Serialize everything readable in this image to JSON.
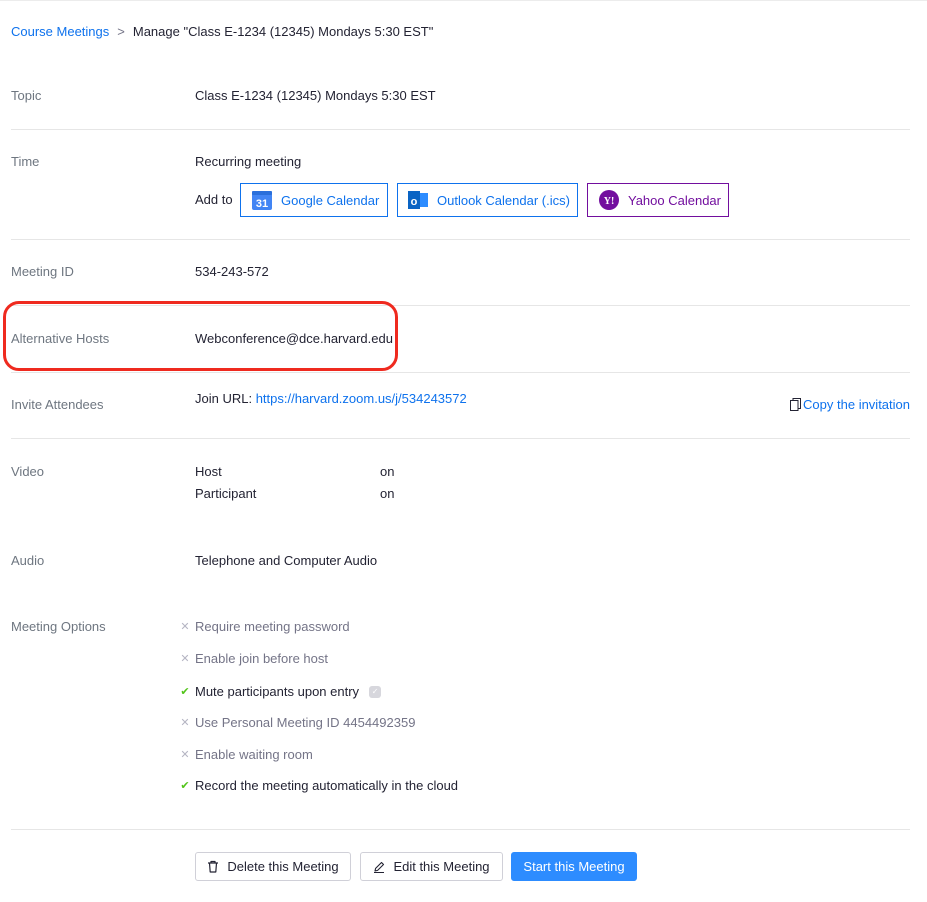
{
  "breadcrumb": {
    "parent": "Course Meetings",
    "separator": ">",
    "current": "Manage \"Class E-1234 (12345) Mondays 5:30 EST\""
  },
  "topic": {
    "label": "Topic",
    "value": "Class E-1234 (12345) Mondays 5:30 EST"
  },
  "time": {
    "label": "Time",
    "value": "Recurring meeting",
    "add_to": "Add to",
    "calendars": {
      "google": {
        "label": "Google Calendar",
        "icon": "google-calendar-icon",
        "icon_text": "31",
        "color": "#0e72ed"
      },
      "outlook": {
        "label": "Outlook Calendar (.ics)",
        "icon": "outlook-icon",
        "icon_text": "o",
        "color": "#0e72ed"
      },
      "yahoo": {
        "label": "Yahoo Calendar",
        "icon": "yahoo-icon",
        "icon_text": "Y!",
        "color": "#720e9e"
      }
    }
  },
  "meeting_id": {
    "label": "Meeting ID",
    "value": "534-243-572"
  },
  "alt_hosts": {
    "label": "Alternative Hosts",
    "value": "Webconference@dce.harvard.edu",
    "highlight_color": "#ef2a1f"
  },
  "invite": {
    "label": "Invite Attendees",
    "join_prefix": "Join URL:",
    "join_url": "https://harvard.zoom.us/j/534243572",
    "copy_label": "Copy the invitation"
  },
  "video": {
    "label": "Video",
    "host_label": "Host",
    "host_value": "on",
    "participant_label": "Participant",
    "participant_value": "on"
  },
  "audio": {
    "label": "Audio",
    "value": "Telephone and Computer Audio"
  },
  "options": {
    "label": "Meeting Options",
    "items": [
      {
        "label": "Require meeting password",
        "enabled": false
      },
      {
        "label": "Enable join before host",
        "enabled": false
      },
      {
        "label": "Mute participants upon entry",
        "enabled": true
      },
      {
        "label": "Use Personal Meeting ID 4454492359",
        "enabled": false
      },
      {
        "label": "Enable waiting room",
        "enabled": false
      },
      {
        "label": "Record the meeting automatically in the cloud",
        "enabled": true
      }
    ]
  },
  "actions": {
    "delete": "Delete this Meeting",
    "edit": "Edit this Meeting",
    "start": "Start this Meeting"
  },
  "colors": {
    "accent": "#0e72ed",
    "primary_button": "#2d8cff",
    "check": "#52c41a"
  }
}
